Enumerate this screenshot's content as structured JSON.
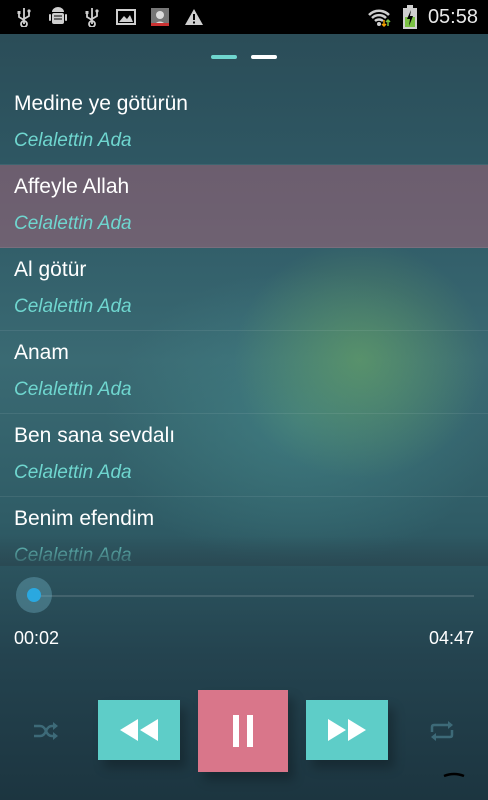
{
  "status_bar": {
    "time": "05:58",
    "icons": [
      "usb-icon",
      "android-debug-icon",
      "usb-icon",
      "image-icon",
      "profile-image-icon",
      "warning-icon",
      "wifi-icon",
      "battery-charging-icon"
    ]
  },
  "pager": {
    "pages": 2,
    "active_index": 0
  },
  "playlist": {
    "items": [
      {
        "title": "Medine ye götürün",
        "artist": "Celalettin Ada",
        "selected": false
      },
      {
        "title": "Affeyle Allah",
        "artist": "Celalettin Ada",
        "selected": true
      },
      {
        "title": "Al götür",
        "artist": "Celalettin Ada",
        "selected": false
      },
      {
        "title": "Anam",
        "artist": "Celalettin Ada",
        "selected": false
      },
      {
        "title": "Ben sana sevdalı",
        "artist": "Celalettin Ada",
        "selected": false
      },
      {
        "title": "Benim efendim",
        "artist": "Celalettin Ada",
        "selected": false
      }
    ]
  },
  "player": {
    "current_time": "00:02",
    "duration": "04:47",
    "progress": 0.007,
    "state": "playing"
  },
  "colors": {
    "accent_teal": "#5ecdc8",
    "accent_pink": "#d9768a",
    "artist_text": "#6fd6cf",
    "selected_row": "#a06478"
  }
}
